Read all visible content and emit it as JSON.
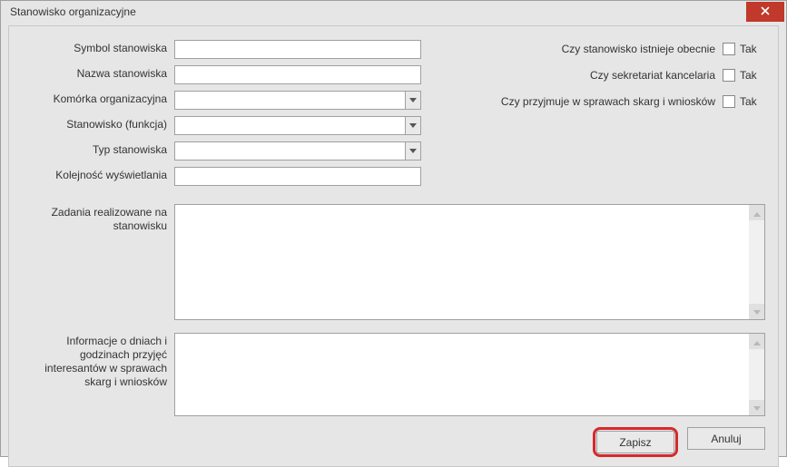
{
  "window": {
    "title": "Stanowisko organizacyjne"
  },
  "labels": {
    "symbol": "Symbol stanowiska",
    "nazwa": "Nazwa stanowiska",
    "komorka": "Komórka organizacyjna",
    "stanowisko": "Stanowisko (funkcja)",
    "typ": "Typ stanowiska",
    "kolejnosc": "Kolejność wyświetlania",
    "zadania": "Zadania realizowane na stanowisku",
    "informacje": "Informacje o dniach i godzinach przyjęć interesantów w sprawach skarg i wniosków"
  },
  "values": {
    "symbol": "",
    "nazwa": "",
    "komorka": "",
    "stanowisko": "",
    "typ": "",
    "kolejnosc": "",
    "zadania": "",
    "informacje": ""
  },
  "checks": {
    "istnieje_label": "Czy stanowisko istnieje obecnie",
    "sekretariat_label": "Czy sekretariat kancelaria",
    "skargi_label": "Czy przyjmuje w sprawach skarg i wniosków",
    "tak": "Tak"
  },
  "buttons": {
    "zapisz": "Zapisz",
    "anuluj": "Anuluj"
  }
}
